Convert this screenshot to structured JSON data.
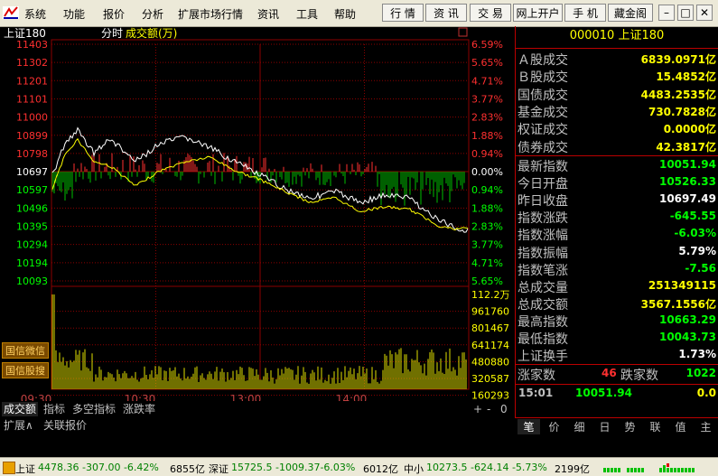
{
  "menu": {
    "items": [
      "系统",
      "功能",
      "报价",
      "分析",
      "扩展市场行情",
      "资讯",
      "工具",
      "帮助"
    ],
    "toolbar": [
      "行 情",
      "资 讯",
      "交 易",
      "网上开户",
      "手 机",
      "藏金阁"
    ]
  },
  "window_buttons": [
    "–",
    "□",
    "✕"
  ],
  "chart": {
    "header_name": "上证180",
    "header_mode": "分时",
    "header_vol": "成交额(万)",
    "price_ticks": [
      "11403",
      "11302",
      "11201",
      "11101",
      "11000",
      "10899",
      "10798",
      "10697",
      "10597",
      "10496",
      "10395",
      "10294",
      "10194",
      "10093"
    ],
    "pct_ticks": [
      "6.59%",
      "5.65%",
      "4.71%",
      "3.77%",
      "2.83%",
      "1.88%",
      "0.94%",
      "0.00%",
      "0.94%",
      "1.88%",
      "2.83%",
      "3.77%",
      "4.71%",
      "5.65%"
    ],
    "vol_ticks": [
      "112.2万",
      "961760",
      "801467",
      "641174",
      "480880",
      "320587",
      "160293"
    ],
    "time_labels": [
      "09:30",
      "10:30",
      "13:00",
      "14:00"
    ],
    "side_buttons": [
      "国信微信",
      "国信股搜"
    ]
  },
  "bottom_tabs": [
    "成交额",
    "指标",
    "多空指标",
    "涨跌率"
  ],
  "bottom_tabs2": [
    "扩展∧",
    "关联报价"
  ],
  "scroll_controls": [
    "+",
    "-",
    "0"
  ],
  "right_panel": {
    "code": "000010",
    "name": "上证180",
    "rows1": [
      {
        "label": "Ａ股成交",
        "value": "6839.0971亿"
      },
      {
        "label": "Ｂ股成交",
        "value": "15.4852亿"
      },
      {
        "label": "国债成交",
        "value": "4483.2535亿"
      },
      {
        "label": "基金成交",
        "value": "730.7828亿"
      },
      {
        "label": "权证成交",
        "value": "0.0000亿"
      },
      {
        "label": "债券成交",
        "value": "42.3817亿"
      }
    ],
    "rows2": [
      {
        "label": "最新指数",
        "value": "10051.94",
        "color": "#00ff00"
      },
      {
        "label": "今日开盘",
        "value": "10526.33",
        "color": "#00ff00"
      },
      {
        "label": "昨日收盘",
        "value": "10697.49",
        "color": "#ffffff"
      },
      {
        "label": "指数涨跌",
        "value": "-645.55",
        "color": "#00ff00"
      },
      {
        "label": "指数涨幅",
        "value": "-6.03%",
        "color": "#00ff00"
      },
      {
        "label": "指数振幅",
        "value": "5.79%",
        "color": "#ffffff"
      },
      {
        "label": "指数笔涨",
        "value": "-7.56",
        "color": "#00ff00"
      },
      {
        "label": "总成交量",
        "value": "251349115",
        "color": "#ffff00"
      },
      {
        "label": "总成交额",
        "value": "3567.1556亿",
        "color": "#ffff00"
      },
      {
        "label": "最高指数",
        "value": "10663.29",
        "color": "#00ff00"
      },
      {
        "label": "最低指数",
        "value": "10043.73",
        "color": "#00ff00"
      },
      {
        "label": "上证换手",
        "value": "1.73%",
        "color": "#ffffff"
      }
    ],
    "up_label": "涨家数",
    "up_value": "46",
    "down_label": "跌家数",
    "down_value": "1022",
    "tick_time": "15:01",
    "tick_price": "10051.94",
    "tick_vol": "0.0",
    "tabs": [
      "笔",
      "价",
      "细",
      "日",
      "势",
      "联",
      "值",
      "主"
    ]
  },
  "status": {
    "sh_label": "上证",
    "sh_vals": "4478.36 -307.00 -6.42%",
    "sh_amt": "6855亿",
    "sz_label": "深证",
    "sz_vals": "15725.5 -1009.37-6.03%",
    "sz_amt": "6012亿",
    "zx_label": "中小",
    "zx_vals": "10273.5 -624.14 -5.73%",
    "zx_amt": "2199亿"
  },
  "colors": {
    "up": "#ff3030",
    "down": "#00ff00",
    "yellow": "#ffff00",
    "grid": "#8b0000"
  }
}
